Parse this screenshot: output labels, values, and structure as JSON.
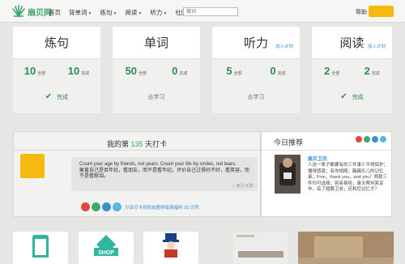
{
  "nav": {
    "logo_text": "扇贝网",
    "items": [
      {
        "label": "首页",
        "caret": false
      },
      {
        "label": "背单词",
        "caret": true
      },
      {
        "label": "练句",
        "caret": true
      },
      {
        "label": "阅读",
        "caret": true
      },
      {
        "label": "听力",
        "caret": true
      },
      {
        "label": "社区",
        "caret": true
      }
    ],
    "search_placeholder": "搜词",
    "help": "帮助",
    "accent": "#f4bb0e",
    "brand": "#3fa76f"
  },
  "cards": [
    {
      "title": "炼句",
      "link": "",
      "total": "10",
      "total_unit": "全部",
      "done": "10",
      "done_unit": "完成",
      "footer": "完成",
      "status": "done"
    },
    {
      "title": "单词",
      "link": "",
      "total": "50",
      "total_unit": "全部",
      "done": "0",
      "done_unit": "完成",
      "footer": "去学习",
      "status": "todo"
    },
    {
      "title": "听力",
      "link": "加入计划",
      "total": "5",
      "total_unit": "全部",
      "done": "0",
      "done_unit": "完成",
      "footer": "去学习",
      "status": "todo"
    },
    {
      "title": "阅读",
      "link": "加入计划",
      "total": "2",
      "total_unit": "全部",
      "done": "2",
      "done_unit": "完成",
      "footer": "完成",
      "status": "done"
    }
  ],
  "checkin": {
    "title_prefix": "我的第",
    "days": "135",
    "title_suffix": "天打卡",
    "quote_en": "Count your age by friends, not years. Count your life by smiles, not tears.",
    "quote_cn": "衡量自己是否年轻，看朋友，而不是看年纪。评价自己过得好不好，看笑容，而不是看眼泪。",
    "quote_source": "— 扇贝·乐群",
    "share_note": "分享打卡到朋友圈得每周福利 25 贝壳"
  },
  "recommend": {
    "title": "今日推荐",
    "book_title": "扇贝卫衣",
    "description": "人这一辈子都要有的三件事少不得保护；懂得感恩；有你相随；踢踢乐儿的记忆录；Fine，thank you，and you？两款三件均可选择；别容易啦，奋天帮何笑享作，有了翅膀卫衣，还和您记忆才？"
  }
}
